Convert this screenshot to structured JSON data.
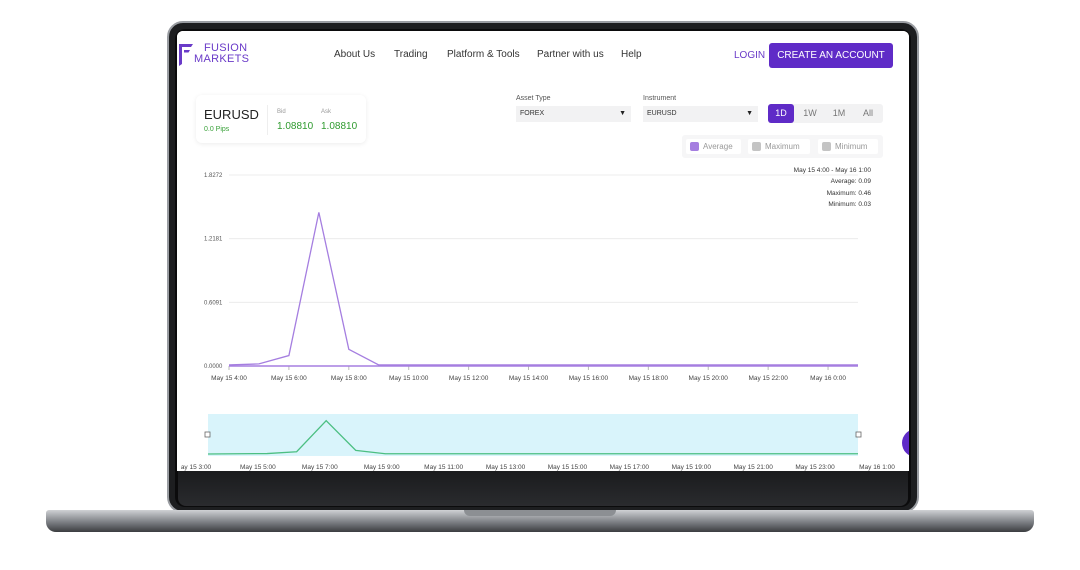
{
  "brand": {
    "line1": "FUSION",
    "line2": "MARKETS",
    "color": "#6a3bc8"
  },
  "nav": {
    "items": [
      "About Us",
      "Trading",
      "Platform & Tools",
      "Partner with us",
      "Help"
    ],
    "login": "LOGIN",
    "cta": "CREATE AN ACCOUNT"
  },
  "quote": {
    "pair": "EURUSD",
    "pips": "0.0 Pips",
    "bid_label": "Bid",
    "bid": "1.08810",
    "ask_label": "Ask",
    "ask": "1.08810"
  },
  "filters": {
    "asset_label": "Asset Type",
    "asset_value": "FOREX",
    "instrument_label": "Instrument",
    "instrument_value": "EURUSD",
    "ranges": [
      "1D",
      "1W",
      "1M",
      "All"
    ],
    "active_range": "1D"
  },
  "toggles": {
    "average": "Average",
    "maximum": "Maximum",
    "minimum": "Minimum",
    "average_color": "#a57ee0",
    "off_color": "#c4c4c4"
  },
  "stats": {
    "range": "May 15 4:00 - May 16 1:00",
    "average": "Average: 0.09",
    "maximum": "Maximum: 0.46",
    "minimum": "Minimum: 0.03"
  },
  "chart_data": {
    "type": "line",
    "x": [
      "May 15 4:00",
      "May 15 5:00",
      "May 15 6:00",
      "May 15 7:00",
      "May 15 8:00",
      "May 15 9:00",
      "May 15 10:00",
      "May 15 11:00",
      "May 15 12:00",
      "May 15 13:00",
      "May 15 14:00",
      "May 15 15:00",
      "May 15 16:00",
      "May 15 17:00",
      "May 15 18:00",
      "May 15 19:00",
      "May 15 20:00",
      "May 15 21:00",
      "May 15 22:00",
      "May 15 23:00",
      "May 16 0:00",
      "May 16 1:00"
    ],
    "x_ticks": [
      "May 15 4:00",
      "May 15 6:00",
      "May 15 8:00",
      "May 15 10:00",
      "May 15 12:00",
      "May 15 14:00",
      "May 15 16:00",
      "May 15 18:00",
      "May 15 20:00",
      "May 15 22:00",
      "May 16 0:00"
    ],
    "series": [
      {
        "values": [
          0.01,
          0.02,
          0.1,
          1.47,
          0.16,
          0.01,
          0.01,
          0.01,
          0.01,
          0.01,
          0.01,
          0.01,
          0.01,
          0.01,
          0.01,
          0.01,
          0.01,
          0.01,
          0.01,
          0.01,
          0.01,
          0.01
        ],
        "color": "#a57ee0"
      }
    ],
    "y_ticks": [
      "0.0000",
      "0.6091",
      "1.2181",
      "1.8272"
    ],
    "ylim": [
      0,
      1.8272
    ],
    "grid": true,
    "navigator": {
      "x_ticks": [
        "ay 15 3:00",
        "May 15 5:00",
        "May 15 7:00",
        "May 15 9:00",
        "May 15 11:00",
        "May 15 13:00",
        "May 15 15:00",
        "May 15 17:00",
        "May 15 19:00",
        "May 15 21:00",
        "May 15 23:00",
        "May 16 1:00"
      ],
      "line_color": "#4cbf82",
      "fill_color": "#d9f4fb"
    }
  }
}
